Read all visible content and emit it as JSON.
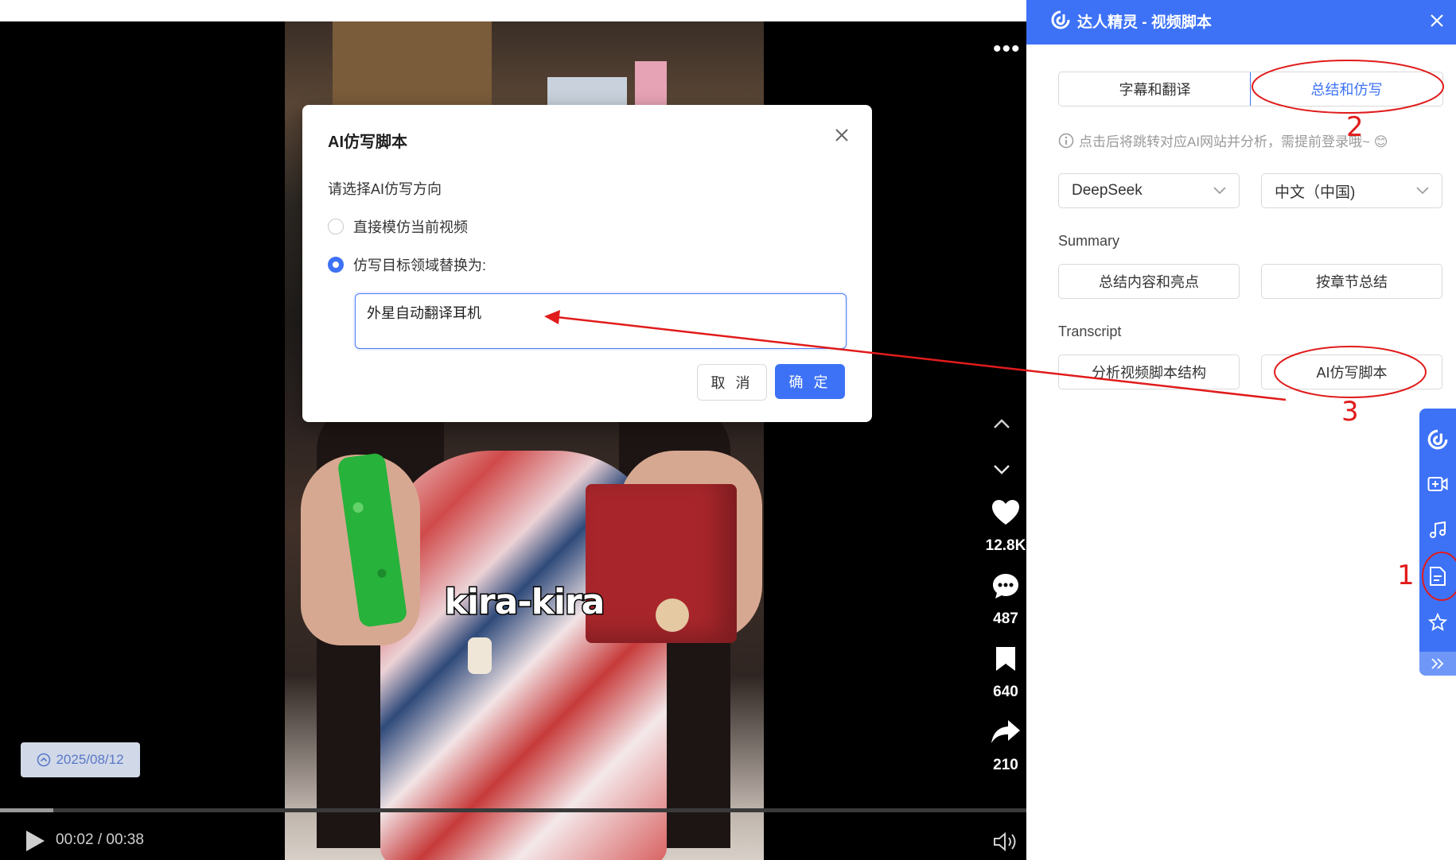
{
  "video": {
    "caption": "kira-kira",
    "date_badge": "2025/08/12",
    "time": "00:02 / 00:38",
    "progress_pct": 5.2,
    "likes": "12.8K",
    "comments": "487",
    "bookmarks": "640",
    "shares": "210"
  },
  "modal": {
    "title": "AI仿写脚本",
    "subtitle": "请选择AI仿写方向",
    "option1": "直接模仿当前视频",
    "option2": "仿写目标领域替换为:",
    "input_value": "外星自动翻译耳机",
    "cancel_label": "取 消",
    "ok_label": "确 定",
    "selected_option": 2
  },
  "panel": {
    "title": "达人精灵 - 视频脚本",
    "tabs": [
      "字幕和翻译",
      "总结和仿写"
    ],
    "active_tab": 1,
    "hint": "点击后将跳转对应AI网站并分析，需提前登录哦~ 😊",
    "model_select": "DeepSeek",
    "language_select": "中文（中国)",
    "summary_label": "Summary",
    "summary_btn1": "总结内容和亮点",
    "summary_btn2": "按章节总结",
    "transcript_label": "Transcript",
    "transcript_btn1": "分析视频脚本结构",
    "transcript_btn2": "AI仿写脚本"
  },
  "annotations": {
    "step1": "1",
    "step2": "2",
    "step3": "3"
  },
  "colors": {
    "accent": "#3d72f6",
    "annotation": "#e11b1b"
  },
  "icons": [
    "more-icon",
    "chevron-up-icon",
    "chevron-down-icon",
    "heart-icon",
    "comment-icon",
    "bookmark-icon",
    "share-icon",
    "play-icon",
    "volume-icon",
    "close-icon",
    "info-icon",
    "logo-icon",
    "video-add-icon",
    "music-icon",
    "document-icon",
    "star-icon",
    "double-chevron-right-icon"
  ]
}
